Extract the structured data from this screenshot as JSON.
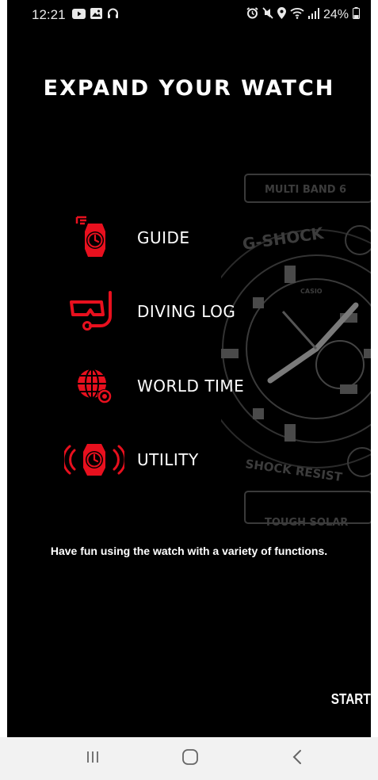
{
  "status_bar": {
    "time": "12:21",
    "left_icons": [
      "youtube-icon",
      "gallery-icon",
      "headphones-icon"
    ],
    "right_icons": [
      "alarm-icon",
      "mute-icon",
      "location-icon",
      "wifi-icon",
      "signal-icon",
      "battery-icon"
    ],
    "battery": "24%"
  },
  "header": {
    "title": "EXPAND YOUR WATCH"
  },
  "menu": {
    "items": [
      {
        "label": "GUIDE",
        "icon": "watch-guide-icon"
      },
      {
        "label": "DIVING LOG",
        "icon": "diving-mask-icon"
      },
      {
        "label": "WORLD TIME",
        "icon": "globe-icon"
      },
      {
        "label": "UTILITY",
        "icon": "watch-vibrate-icon"
      }
    ]
  },
  "tagline": "Have fun using the watch with a variety of functions.",
  "start_label": "START",
  "colors": {
    "accent": "#e8101e",
    "background": "#000000",
    "text": "#ffffff",
    "nav_bar": "#f2f2f2"
  },
  "nav_bar": {
    "buttons": [
      "recents-icon",
      "home-icon",
      "back-icon"
    ]
  }
}
